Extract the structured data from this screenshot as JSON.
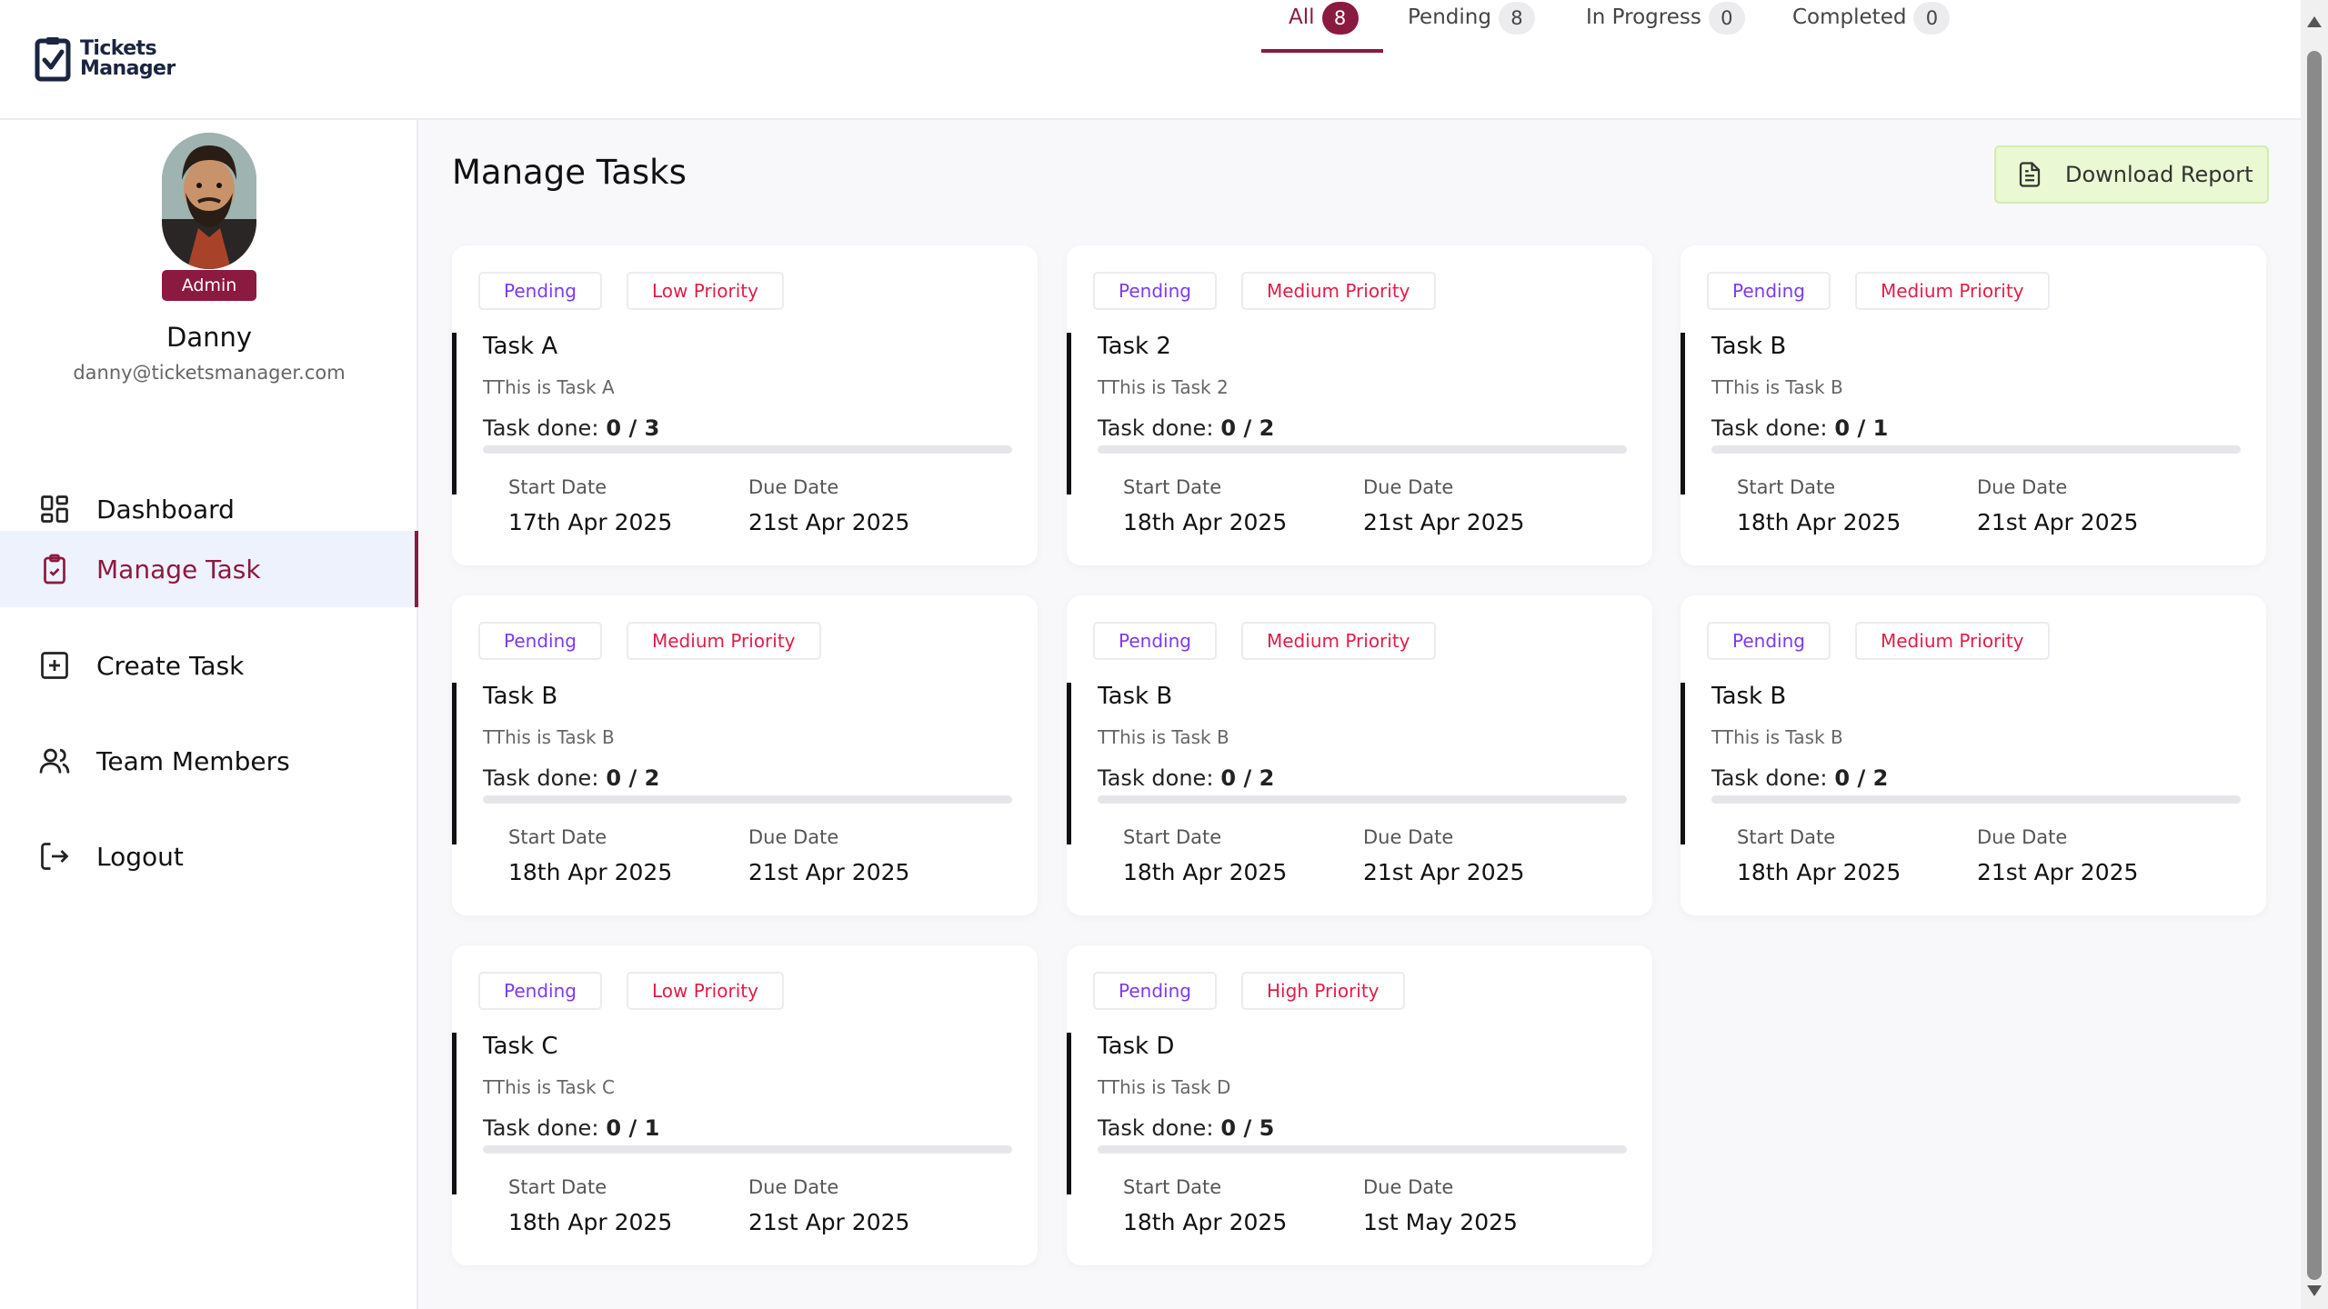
{
  "app": {
    "logo_line1": "Tickets",
    "logo_line2": "Manager"
  },
  "user": {
    "name": "Danny",
    "email": "danny@ticketsmanager.com",
    "role": "Admin"
  },
  "nav": [
    {
      "label": "Dashboard",
      "icon": "dashboard-icon"
    },
    {
      "label": "Manage Task",
      "icon": "clipboard-check-icon",
      "active": true
    },
    {
      "label": "Create Task",
      "icon": "plus-square-icon"
    },
    {
      "label": "Team Members",
      "icon": "users-icon"
    },
    {
      "label": "Logout",
      "icon": "logout-icon"
    }
  ],
  "main": {
    "title": "Manage Tasks",
    "tabs": [
      {
        "label": "All",
        "count": "8",
        "active": true
      },
      {
        "label": "Pending",
        "count": "8"
      },
      {
        "label": "In Progress",
        "count": "0"
      },
      {
        "label": "Completed",
        "count": "0"
      }
    ],
    "download_label": "Download Report",
    "start_label": "Start Date",
    "due_label": "Due Date",
    "done_label": "Task done:"
  },
  "tasks": [
    {
      "status": "Pending",
      "priority": "Low Priority",
      "title": "Task A",
      "description": "TThis is Task A",
      "done": "0 / 3",
      "progress": 0,
      "start": "17th Apr 2025",
      "due": "21st Apr 2025"
    },
    {
      "status": "Pending",
      "priority": "Medium Priority",
      "title": "Task 2",
      "description": "TThis is Task 2",
      "done": "0 / 2",
      "progress": 0,
      "start": "18th Apr 2025",
      "due": "21st Apr 2025"
    },
    {
      "status": "Pending",
      "priority": "Medium Priority",
      "title": "Task B",
      "description": "TThis is Task B",
      "done": "0 / 1",
      "progress": 0,
      "start": "18th Apr 2025",
      "due": "21st Apr 2025"
    },
    {
      "status": "Pending",
      "priority": "Medium Priority",
      "title": "Task B",
      "description": "TThis is Task B",
      "done": "0 / 2",
      "progress": 0,
      "start": "18th Apr 2025",
      "due": "21st Apr 2025"
    },
    {
      "status": "Pending",
      "priority": "Medium Priority",
      "title": "Task B",
      "description": "TThis is Task B",
      "done": "0 / 2",
      "progress": 0,
      "start": "18th Apr 2025",
      "due": "21st Apr 2025"
    },
    {
      "status": "Pending",
      "priority": "Medium Priority",
      "title": "Task B",
      "description": "TThis is Task B",
      "done": "0 / 2",
      "progress": 0,
      "start": "18th Apr 2025",
      "due": "21st Apr 2025"
    },
    {
      "status": "Pending",
      "priority": "Low Priority",
      "title": "Task C",
      "description": "TThis is Task C",
      "done": "0 / 1",
      "progress": 0,
      "start": "18th Apr 2025",
      "due": "21st Apr 2025"
    },
    {
      "status": "Pending",
      "priority": "High Priority",
      "title": "Task D",
      "description": "TThis is Task D",
      "done": "0 / 5",
      "progress": 0,
      "start": "18th Apr 2025",
      "due": "1st May 2025"
    }
  ],
  "colors": {
    "brand": "#8b1a40",
    "status": "#7c3aed",
    "priority": "#e11d48",
    "download_bg": "#eaf8d3"
  }
}
